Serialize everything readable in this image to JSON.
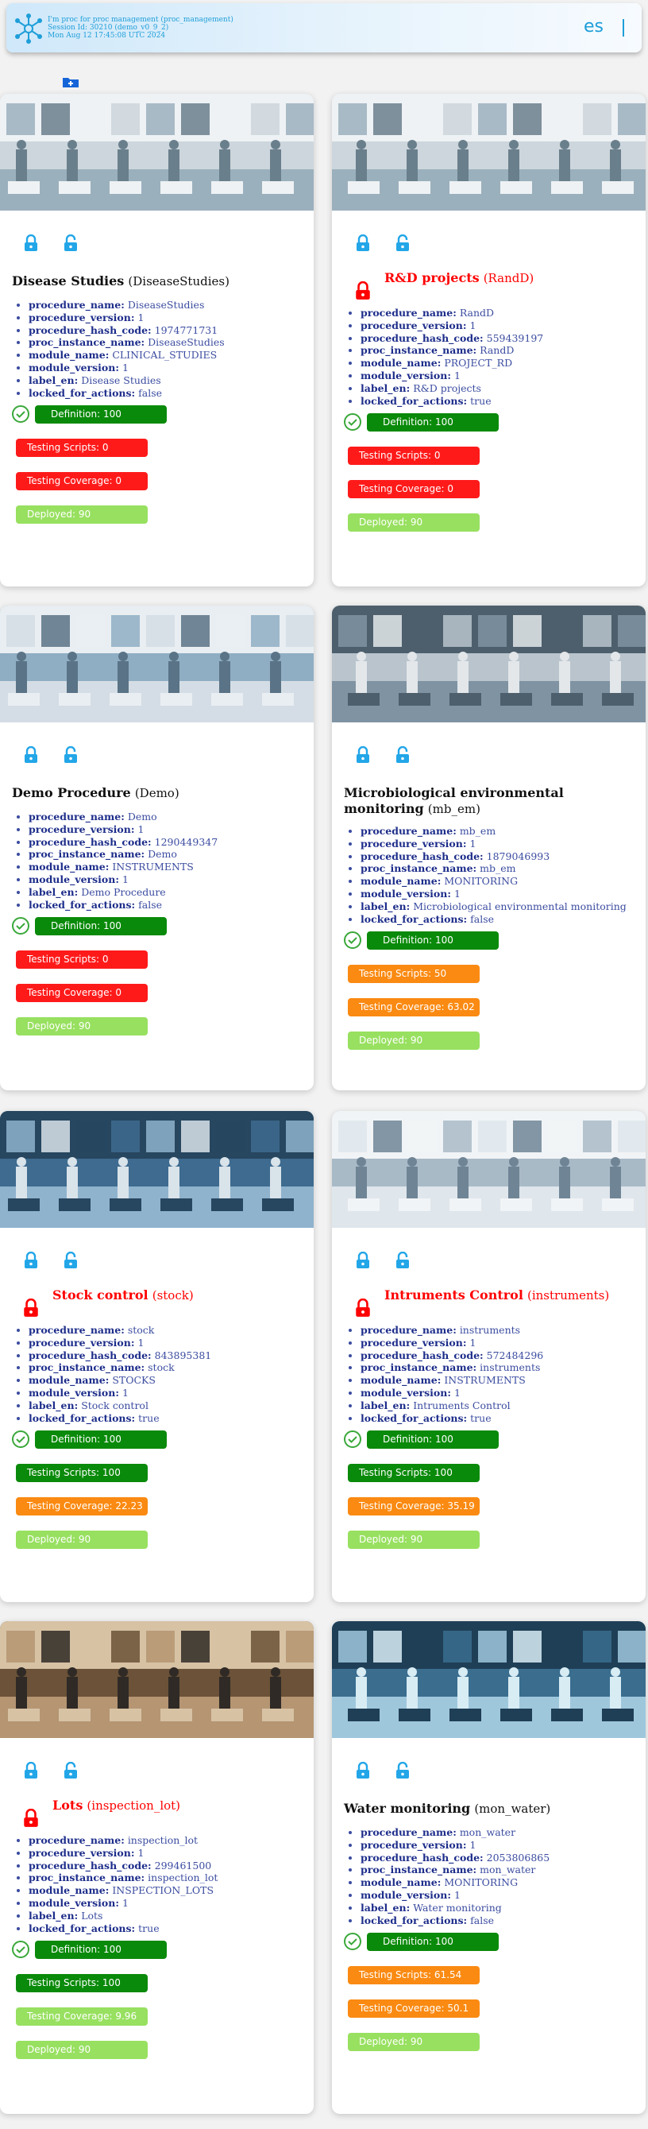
{
  "header": {
    "line1": "I'm proc for proc management (proc_management)",
    "line2": "Session Id: 30210 (demo_v0_9_2)",
    "line3": "Mon Aug 12 17:45:08 UTC 2024",
    "lang": "es",
    "separator": "|"
  },
  "status_labels": {
    "definition": "Definition: ",
    "testing_scripts": "Testing Scripts: ",
    "testing_coverage": "Testing Coverage: ",
    "deployed": "Deployed: "
  },
  "field_labels": [
    "procedure_name:",
    "procedure_version:",
    "procedure_hash_code:",
    "proc_instance_name:",
    "module_name:",
    "module_version:",
    "label_en:",
    "locked_for_actions:"
  ],
  "cards": [
    {
      "title": "Disease Studies",
      "code": "(DiseaseStudies)",
      "locked": false,
      "fields": [
        "DiseaseStudies",
        "1",
        "1974771731",
        "DiseaseStudies",
        "CLINICAL_STUDIES",
        "1",
        "Disease Studies",
        "false"
      ],
      "definition": "100",
      "testing_scripts": "0",
      "testing_coverage": "0",
      "deployed": "90",
      "colors": [
        "green",
        "red",
        "red",
        "lightgreen"
      ],
      "image": "clinical-research-illustration"
    },
    {
      "title": "R&D projects",
      "code": "(RandD)",
      "locked": true,
      "fields": [
        "RandD",
        "1",
        "559439197",
        "RandD",
        "PROJECT_RD",
        "1",
        "R&D projects",
        "true"
      ],
      "definition": "100",
      "testing_scripts": "0",
      "testing_coverage": "0",
      "deployed": "90",
      "colors": [
        "green",
        "red",
        "red",
        "lightgreen"
      ],
      "image": "clinical-research-illustration"
    },
    {
      "title": "Demo Procedure",
      "code": "(Demo)",
      "locked": false,
      "fields": [
        "Demo",
        "1",
        "1290449347",
        "Demo",
        "INSTRUMENTS",
        "1",
        "Demo Procedure",
        "false"
      ],
      "definition": "100",
      "testing_scripts": "0",
      "testing_coverage": "0",
      "deployed": "90",
      "colors": [
        "green",
        "red",
        "red",
        "lightgreen"
      ],
      "image": "instrument-lab-photo"
    },
    {
      "title": "Microbiological environmental monitoring",
      "code": "(mb_em)",
      "locked": false,
      "fields": [
        "mb_em",
        "1",
        "1879046993",
        "mb_em",
        "MONITORING",
        "1",
        "Microbiological environmental monitoring",
        "false"
      ],
      "definition": "100",
      "testing_scripts": "50",
      "testing_coverage": "63.02",
      "deployed": "90",
      "colors": [
        "green",
        "orange",
        "orange",
        "lightgreen"
      ],
      "image": "microbiology-lab-photo"
    },
    {
      "title": "Stock control",
      "code": "(stock)",
      "locked": true,
      "fields": [
        "stock",
        "1",
        "843895381",
        "stock",
        "STOCKS",
        "1",
        "Stock control",
        "true"
      ],
      "definition": "100",
      "testing_scripts": "100",
      "testing_coverage": "22.23",
      "deployed": "90",
      "colors": [
        "green",
        "green",
        "orange",
        "lightgreen"
      ],
      "image": "stock-shelves-photo"
    },
    {
      "title": "Intruments Control",
      "code": "(instruments)",
      "locked": true,
      "fields": [
        "instruments",
        "1",
        "572484296",
        "instruments",
        "INSTRUMENTS",
        "1",
        "Intruments Control",
        "true"
      ],
      "definition": "100",
      "testing_scripts": "100",
      "testing_coverage": "35.19",
      "deployed": "90",
      "colors": [
        "green",
        "green",
        "orange",
        "lightgreen"
      ],
      "image": "instruments-lab-photo"
    },
    {
      "title": "Lots",
      "code": "(inspection_lot)",
      "locked": true,
      "fields": [
        "inspection_lot",
        "1",
        "299461500",
        "inspection_lot",
        "INSPECTION_LOTS",
        "1",
        "Lots",
        "true"
      ],
      "definition": "100",
      "testing_scripts": "100",
      "testing_coverage": "9.96",
      "deployed": "90",
      "colors": [
        "green",
        "green",
        "lightgreen",
        "lightgreen"
      ],
      "image": "warehouse-inspection-photo"
    },
    {
      "title": "Water monitoring",
      "code": "(mon_water)",
      "locked": false,
      "fields": [
        "mon_water",
        "1",
        "2053806865",
        "mon_water",
        "MONITORING",
        "1",
        "Water monitoring",
        "false"
      ],
      "definition": "100",
      "testing_scripts": "61.54",
      "testing_coverage": "50.1",
      "deployed": "90",
      "colors": [
        "green",
        "orange",
        "orange",
        "lightgreen"
      ],
      "image": "water-analysis-photo"
    }
  ]
}
